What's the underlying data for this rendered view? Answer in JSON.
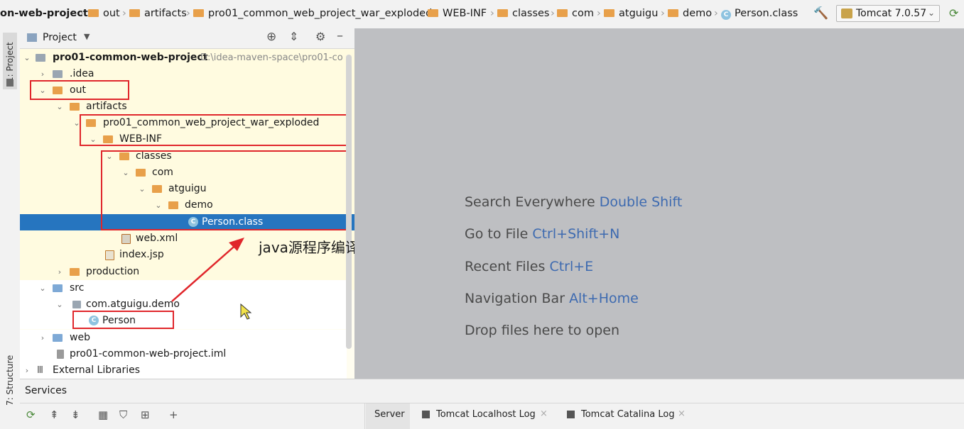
{
  "breadcrumb": {
    "items": [
      "on-web-project",
      "out",
      "artifacts",
      "pro01_common_web_project_war_exploded",
      "WEB-INF",
      "classes",
      "com",
      "atguigu",
      "demo",
      "Person.class"
    ],
    "run_config": "Tomcat 7.0.57"
  },
  "left_strip": {
    "project_tab": "1: Project",
    "structure_tab": "7: Structure"
  },
  "project_panel": {
    "title": "Project",
    "tree": [
      {
        "label": "pro01-common-web-project",
        "path": "D:\\idea-maven-space\\pro01-co"
      },
      {
        "label": ".idea"
      },
      {
        "label": "out"
      },
      {
        "label": "artifacts"
      },
      {
        "label": "pro01_common_web_project_war_exploded"
      },
      {
        "label": "WEB-INF"
      },
      {
        "label": "classes"
      },
      {
        "label": "com"
      },
      {
        "label": "atguigu"
      },
      {
        "label": "demo"
      },
      {
        "label": "Person.class"
      },
      {
        "label": "web.xml"
      },
      {
        "label": "index.jsp"
      },
      {
        "label": "production"
      },
      {
        "label": "src"
      },
      {
        "label": "com.atguigu.demo"
      },
      {
        "label": "Person"
      },
      {
        "label": "web"
      },
      {
        "label": "pro01-common-web-project.iml"
      },
      {
        "label": "External Libraries"
      }
    ]
  },
  "annotation": {
    "text": "java源程序编译以后生成的字节码文件",
    "color": "#e0262b"
  },
  "editor_hints": [
    {
      "text": "Search Everywhere",
      "key": "Double Shift"
    },
    {
      "text": "Go to File",
      "key": "Ctrl+Shift+N"
    },
    {
      "text": "Recent Files",
      "key": "Ctrl+E"
    },
    {
      "text": "Navigation Bar",
      "key": "Alt+Home"
    },
    {
      "text": "Drop files here to open",
      "key": ""
    }
  ],
  "services": {
    "title": "Services",
    "tabs": [
      "Server",
      "Tomcat Localhost Log",
      "Tomcat Catalina Log"
    ]
  },
  "colors": {
    "selection": "#2675bf",
    "folder": "#e8a04a",
    "highlight_box": "#e0262b",
    "key": "#3d6ab0"
  }
}
